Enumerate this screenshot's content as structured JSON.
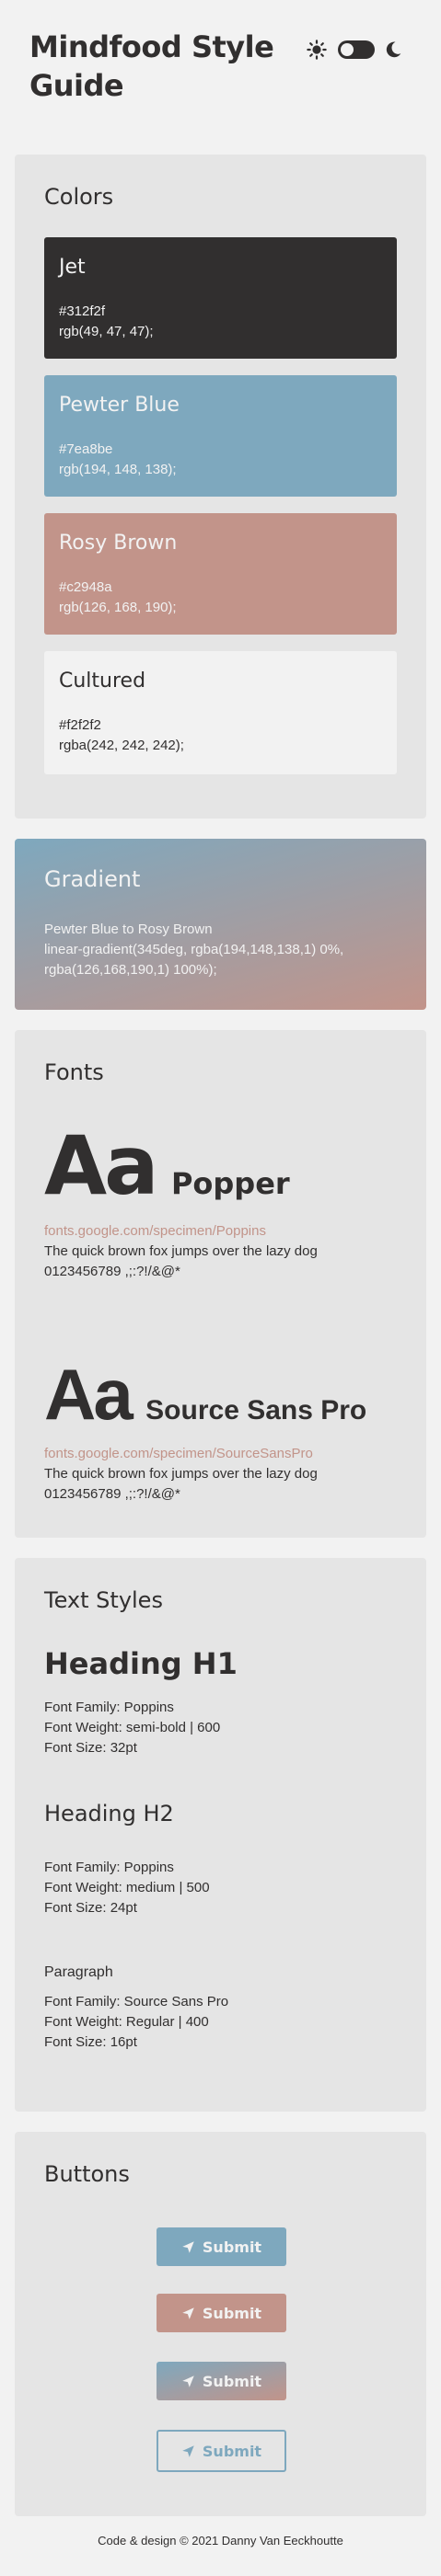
{
  "header": {
    "title_line1": "Mindfood Style",
    "title_line2": "Guide",
    "theme_icons": [
      "sun-icon",
      "toggle-switch",
      "moon-icon"
    ]
  },
  "colors": {
    "title": "Colors",
    "swatches": [
      {
        "name": "Jet",
        "hex": "#312f2f",
        "rgb": "rgb(49, 47, 47);",
        "color": "#312f2f"
      },
      {
        "name": "Pewter Blue",
        "hex": "#7ea8be",
        "rgb": "rgb(194, 148, 138);",
        "color": "#7ea8be"
      },
      {
        "name": "Rosy Brown",
        "hex": "#c2948a",
        "rgb": "rgb(126, 168, 190);",
        "color": "#c2948a"
      },
      {
        "name": "Cultured",
        "hex": "#f2f2f2",
        "rgb": "rgba(242, 242, 242);",
        "color": "#f2f2f2"
      }
    ]
  },
  "gradient": {
    "title": "Gradient",
    "line1": "Pewter Blue to Rosy Brown",
    "line2": "linear-gradient(345deg, rgba(194,148,138,1) 0%,",
    "line3": "rgba(126,168,190,1) 100%);"
  },
  "fonts": {
    "title": "Fonts",
    "items": [
      {
        "sample": "Aa",
        "name": "Popper",
        "link": "fonts.google.com/specimen/Poppins",
        "pangram": "The quick brown fox jumps over the lazy dog",
        "chars": "0123456789 ,;:?!/&@*"
      },
      {
        "sample": "Aa",
        "name": "Source Sans Pro",
        "link": "fonts.google.com/specimen/SourceSansPro",
        "pangram": "The quick brown fox jumps over the lazy dog",
        "chars": "0123456789 ,;:?!/&@*"
      }
    ]
  },
  "text_styles": {
    "title": "Text Styles",
    "h1": {
      "label": "Heading H1",
      "family": "Font Family: Poppins",
      "weight": "Font Weight: semi-bold | 600",
      "size": "Font Size: 32pt"
    },
    "h2": {
      "label": "Heading H2",
      "family": "Font Family: Poppins",
      "weight": "Font Weight: medium | 500",
      "size": "Font Size: 24pt"
    },
    "p": {
      "label": "Paragraph",
      "family": "Font Family: Source Sans Pro",
      "weight": "Font Weight: Regular | 400",
      "size": "Font Size: 16pt"
    }
  },
  "buttons": {
    "title": "Buttons",
    "labels": [
      "Submit",
      "Submit",
      "Submit",
      "Submit"
    ]
  },
  "footer": {
    "text": "Code & design © 2021 Danny Van Eeckhoutte"
  }
}
